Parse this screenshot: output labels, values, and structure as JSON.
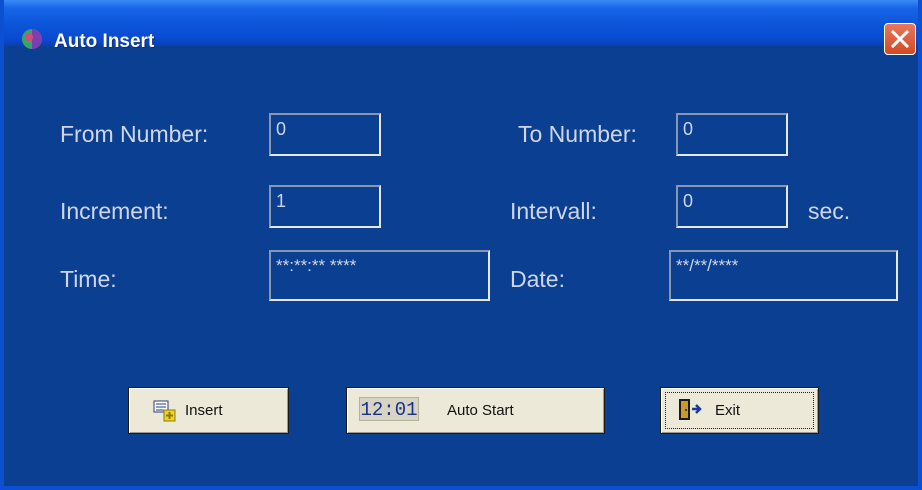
{
  "window": {
    "title": "Auto Insert"
  },
  "form": {
    "from_number": {
      "label": "From Number:",
      "value": "0"
    },
    "to_number": {
      "label": "To Number:",
      "value": "0"
    },
    "increment": {
      "label": "Increment:",
      "value": "1"
    },
    "intervall": {
      "label": "Intervall:",
      "value": "0",
      "unit": "sec."
    },
    "time": {
      "label": "Time:",
      "value": "**:**:** ****"
    },
    "date": {
      "label": "Date:",
      "value": "**/**/****"
    }
  },
  "buttons": {
    "insert": {
      "label": "Insert",
      "icon": "insert-record-icon"
    },
    "auto_start": {
      "label": "Auto Start",
      "icon_text": "12:01",
      "icon": "clock-icon"
    },
    "exit": {
      "label": "Exit",
      "icon": "exit-door-icon"
    }
  },
  "colors": {
    "background": "#0a3f92",
    "titlebar": "#0b54d9",
    "label_text": "#cfd7e6",
    "button_face": "#ece9d8",
    "close_button": "#d24a24"
  }
}
